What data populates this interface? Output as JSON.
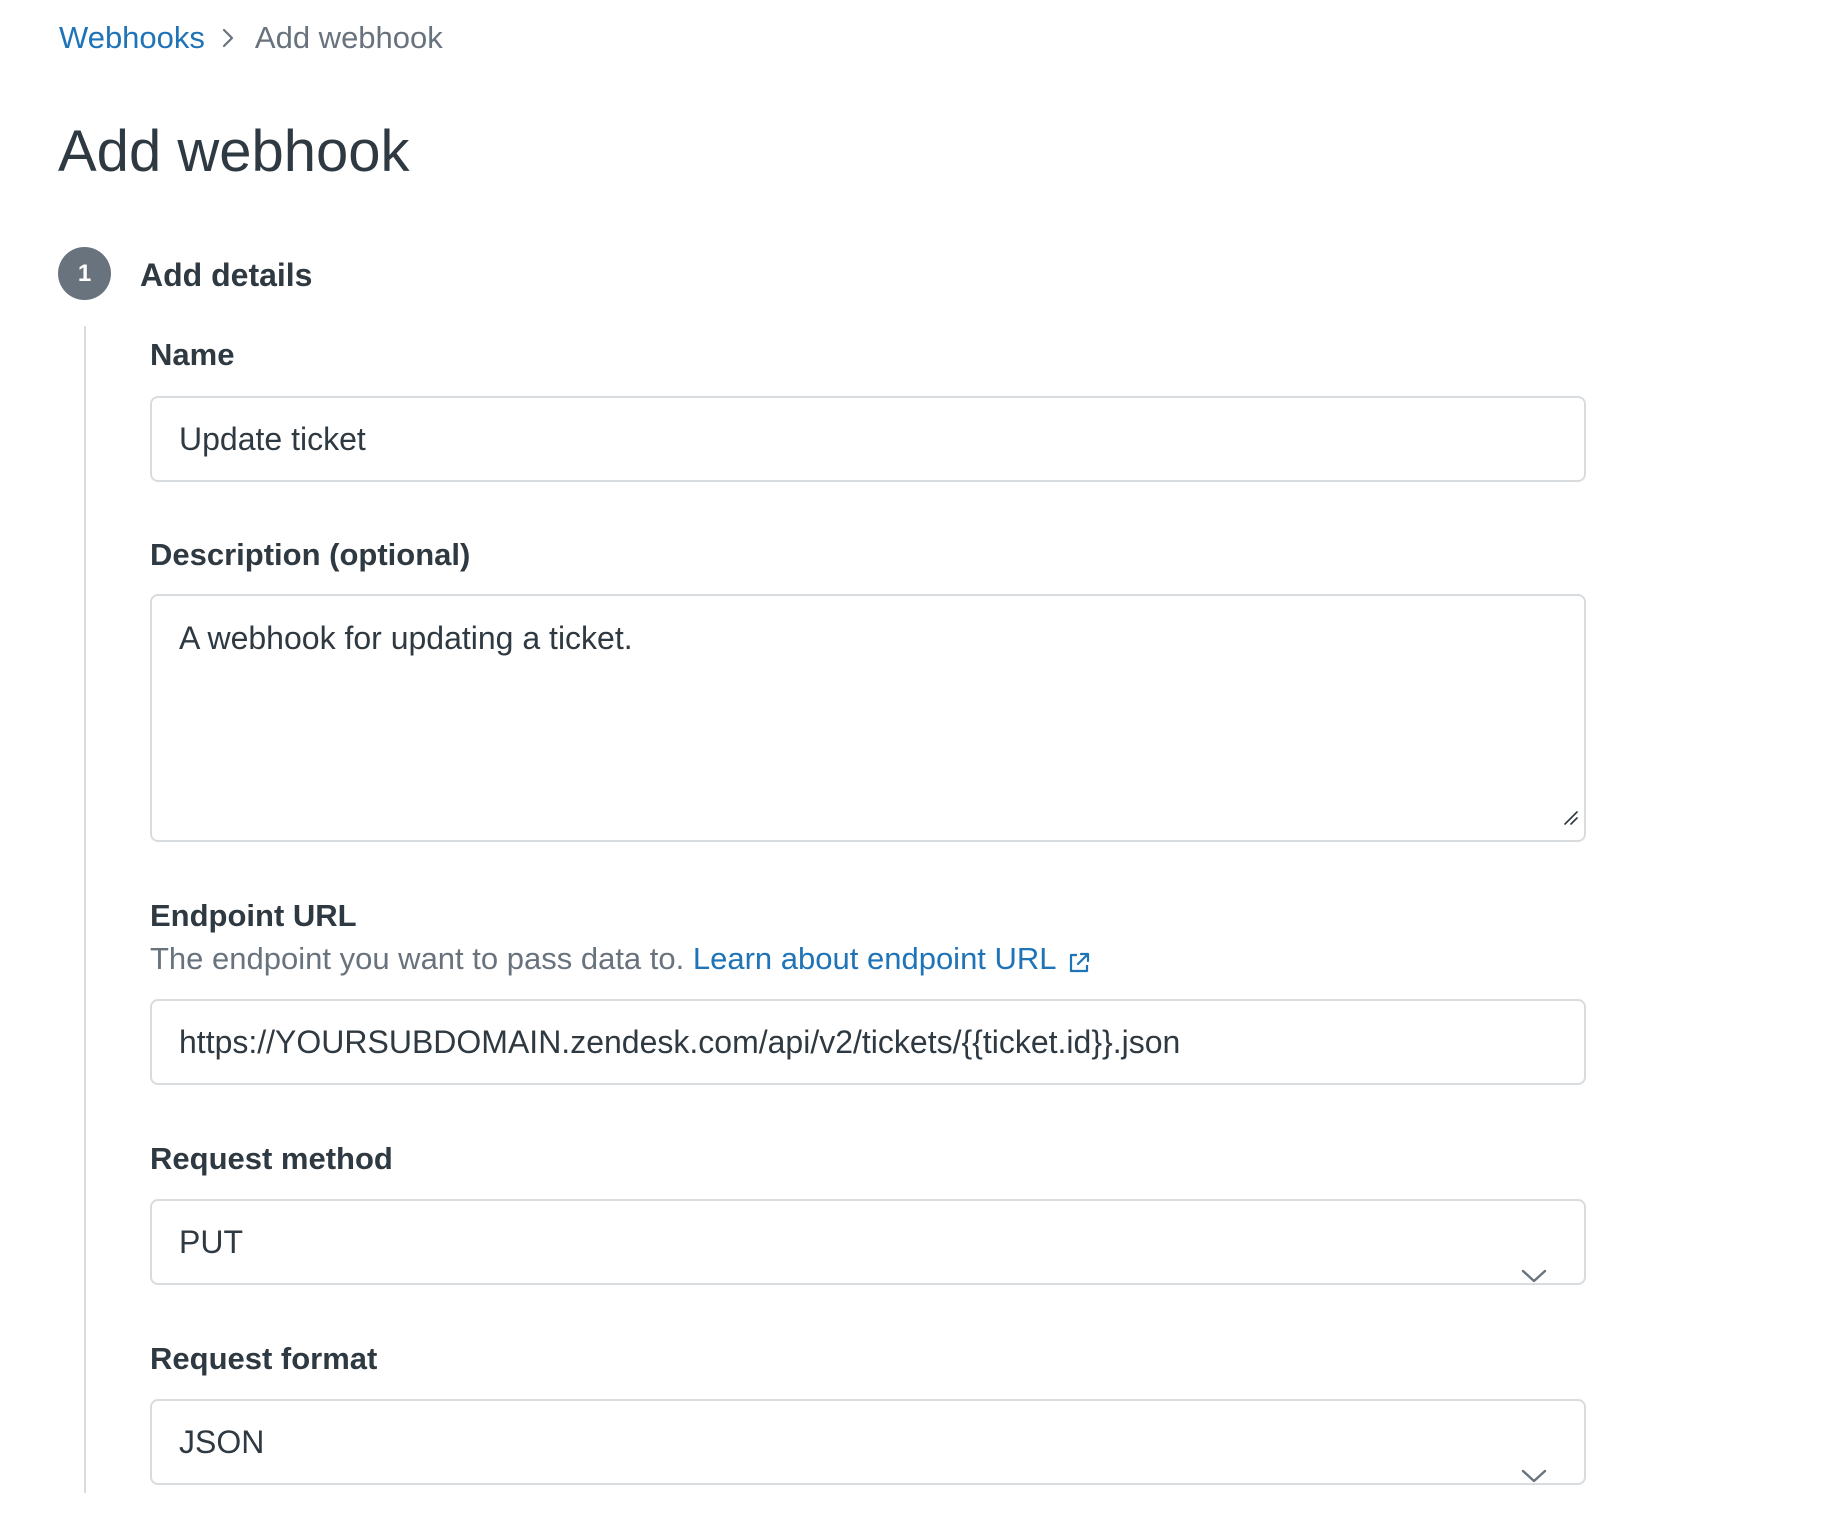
{
  "breadcrumb": {
    "parent_label": "Webhooks",
    "current_label": "Add webhook"
  },
  "page": {
    "title": "Add webhook"
  },
  "step": {
    "number": "1",
    "title": "Add details"
  },
  "form": {
    "name": {
      "label": "Name",
      "value": "Update ticket"
    },
    "description": {
      "label": "Description (optional)",
      "value": "A webhook for updating a ticket."
    },
    "endpoint": {
      "label": "Endpoint URL",
      "hint": "The endpoint you want to pass data to.",
      "link_label": "Learn about endpoint URL",
      "value": "https://YOURSUBDOMAIN.zendesk.com/api/v2/tickets/{{ticket.id}}.json"
    },
    "request_method": {
      "label": "Request method",
      "value": "PUT"
    },
    "request_format": {
      "label": "Request format",
      "value": "JSON"
    }
  },
  "icons": {
    "breadcrumb_separator": "chevron-right-icon",
    "external_link": "external-link-icon",
    "select_arrow": "chevron-down-icon",
    "resize": "resize-grip-icon"
  },
  "colors": {
    "link": "#1f73b7",
    "text": "#2f3941",
    "muted": "#68737d",
    "border": "#d8dcde",
    "badge": "#68737d"
  }
}
